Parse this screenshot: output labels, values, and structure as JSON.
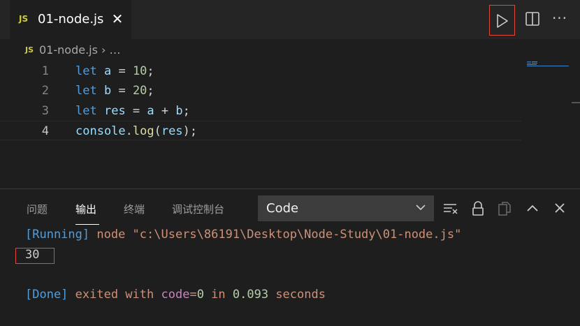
{
  "tab": {
    "badge": "JS",
    "label": "01-node.js",
    "close": "✕"
  },
  "toolbar": {
    "run_icon": "play-icon",
    "split_icon": "split-editor-icon",
    "more": "···"
  },
  "breadcrumb": {
    "badge": "JS",
    "file": "01-node.js",
    "sep": "›",
    "more": "…"
  },
  "editor": {
    "lines": [
      {
        "n": "1",
        "kw": "let",
        "name": "a",
        "op": " = ",
        "val": "10",
        "end": ";"
      },
      {
        "n": "2",
        "kw": "let",
        "name": "b",
        "op": " = ",
        "val": "20",
        "end": ";"
      },
      {
        "n": "3",
        "kw": "let",
        "name": "res",
        "op": " = ",
        "a": "a",
        "plus": " + ",
        "b": "b",
        "end": ";"
      },
      {
        "n": "4",
        "obj": "console",
        "dot": ".",
        "fn": "log",
        "open": "(",
        "arg": "res",
        "close": ");"
      }
    ]
  },
  "panel": {
    "tabs": [
      "问题",
      "输出",
      "终端",
      "调试控制台"
    ],
    "active_tab": "输出",
    "select_value": "Code",
    "icons": [
      "clear-output-icon",
      "lock-icon",
      "copy-icon",
      "chevron-up-icon",
      "close-icon"
    ]
  },
  "output": {
    "running": {
      "tag": "[Running]",
      "cmd": " node \"c:\\Users\\86191\\Desktop\\Node-Study\\01-node.js\""
    },
    "result": "30",
    "done": {
      "tag": "[Done]",
      "text1": " exited with ",
      "code_key": "code",
      "code_eq": "=",
      "code_val": "0",
      "text2": " in ",
      "secs": "0.093",
      "text3": " seconds"
    }
  },
  "colors": {
    "accent_red": "#e04a3a",
    "js_yellow": "#cbcb41",
    "keyword_blue": "#569cd6",
    "string_orange": "#ce9178"
  }
}
